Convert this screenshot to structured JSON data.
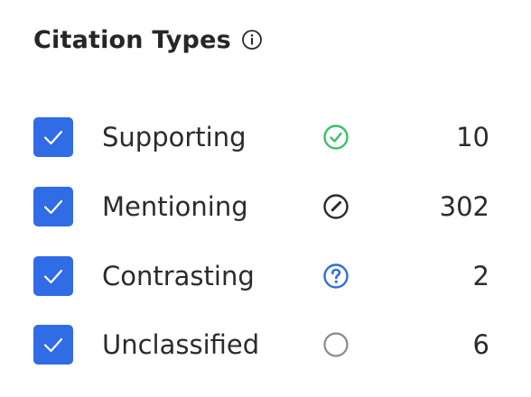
{
  "title": "Citation Types",
  "info_icon": "info-icon",
  "accent_color": "#2f6ce5",
  "items": [
    {
      "label": "Supporting",
      "count": "10",
      "checked": true,
      "icon": "check-circle-icon",
      "icon_color": "#3dbf63"
    },
    {
      "label": "Mentioning",
      "count": "302",
      "checked": true,
      "icon": "slash-circle-icon",
      "icon_color": "#2a2a2a"
    },
    {
      "label": "Contrasting",
      "count": "2",
      "checked": true,
      "icon": "question-circle-icon",
      "icon_color": "#2f6ce5"
    },
    {
      "label": "Unclassified",
      "count": "6",
      "checked": true,
      "icon": "empty-circle-icon",
      "icon_color": "#8a8a8a"
    }
  ]
}
